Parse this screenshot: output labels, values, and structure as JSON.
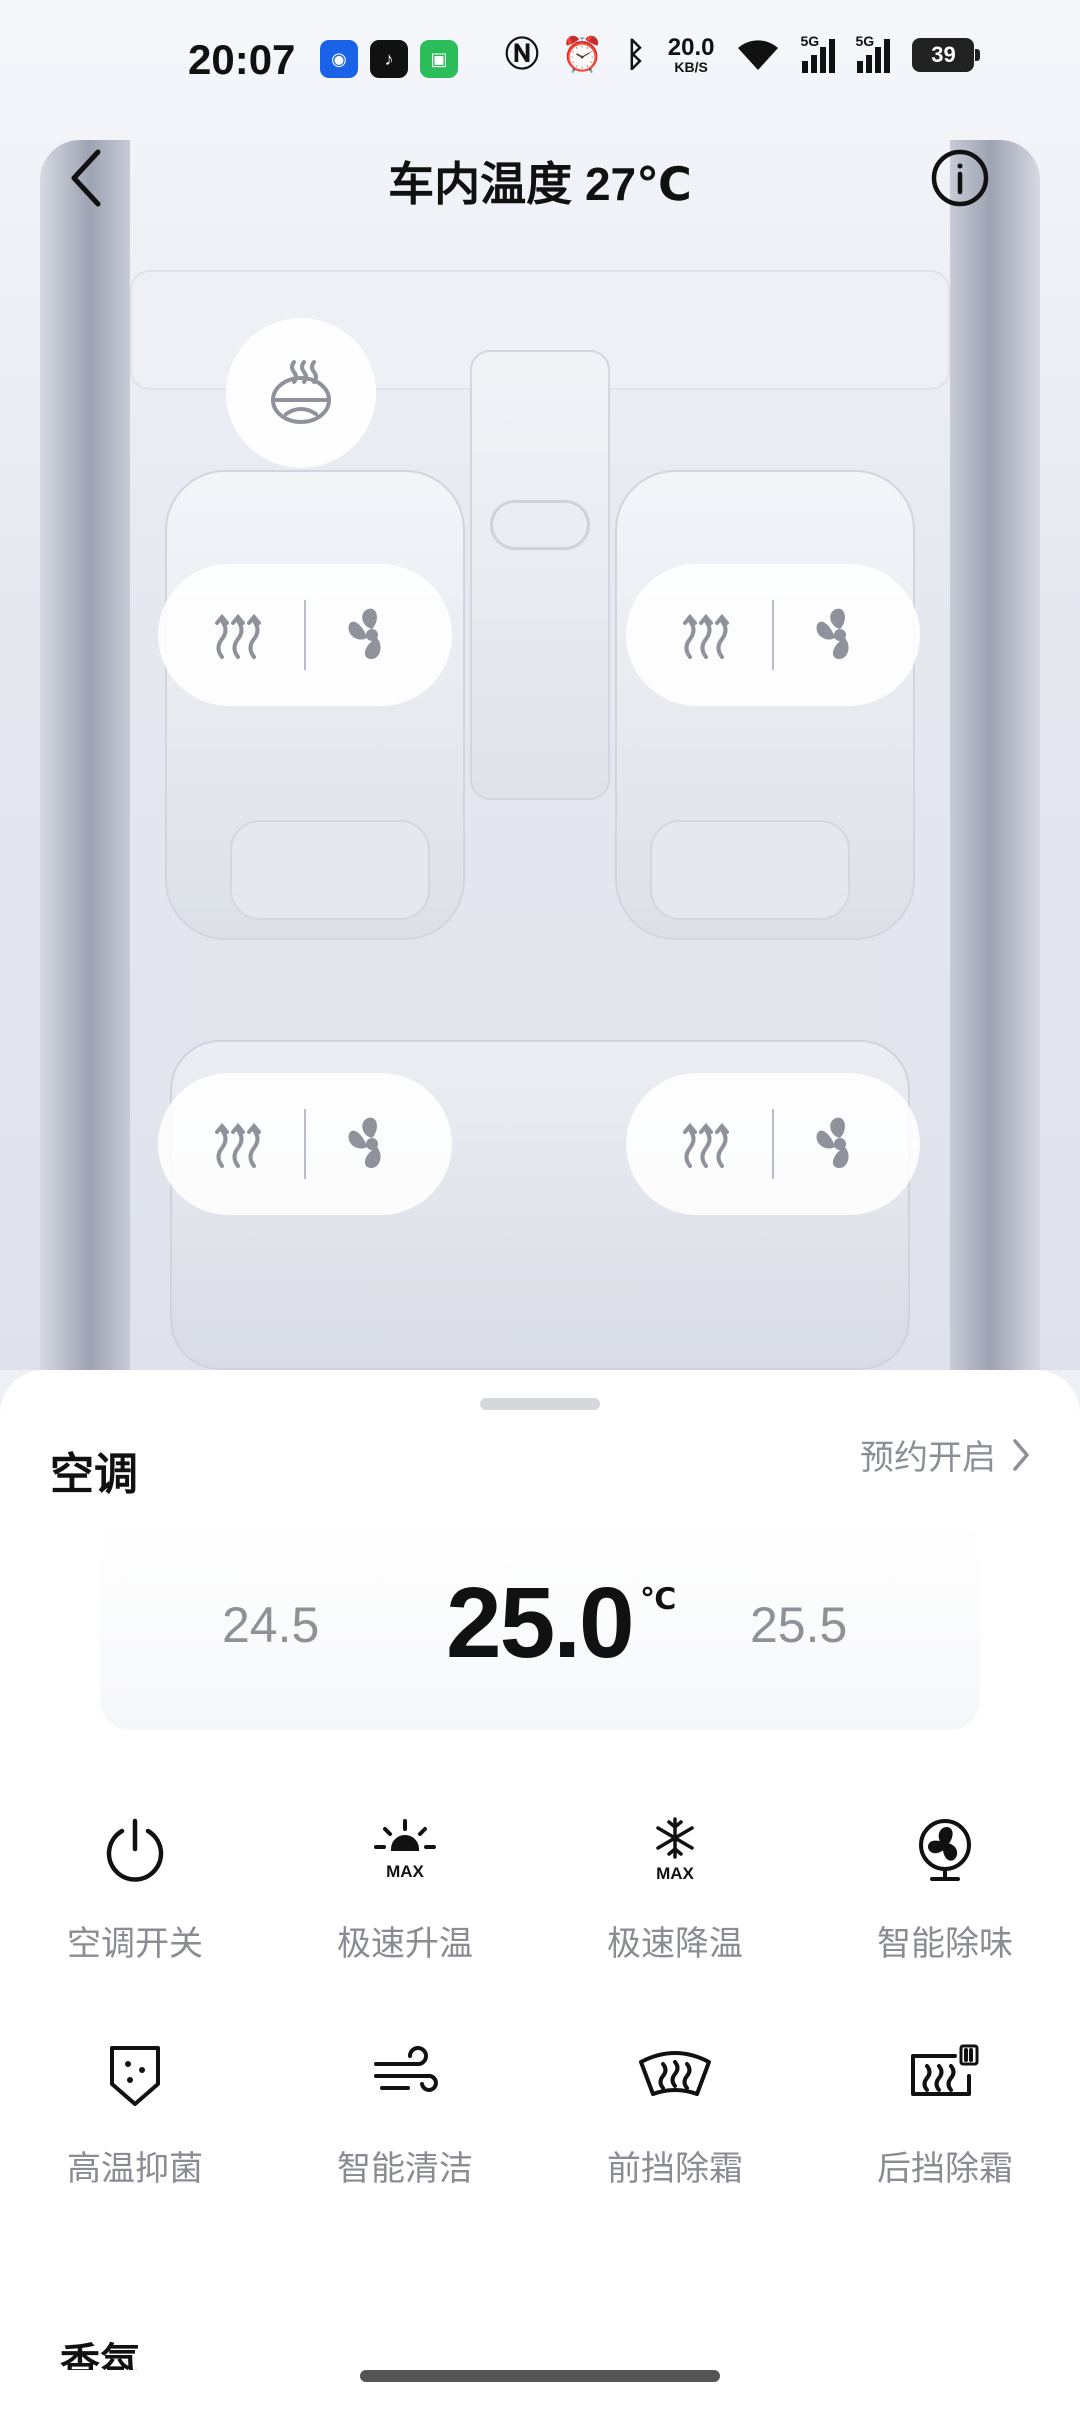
{
  "status_bar": {
    "time": "20:07",
    "net_speed_value": "20.0",
    "net_speed_unit": "KB/S",
    "signal1_tag": "5G",
    "signal2_tag": "5G",
    "battery": "39"
  },
  "header": {
    "title": "车内温度 27℃",
    "back_icon": "chevron-left-icon",
    "info_icon": "info-icon"
  },
  "car": {
    "steering_heat_icon": "steering-wheel-heat-icon",
    "seats": [
      {
        "position": "front-left",
        "heat_icon": "seat-heat-icon",
        "fan_icon": "seat-ventilation-icon"
      },
      {
        "position": "front-right",
        "heat_icon": "seat-heat-icon",
        "fan_icon": "seat-ventilation-icon"
      },
      {
        "position": "rear-left",
        "heat_icon": "seat-heat-icon",
        "fan_icon": "seat-ventilation-icon"
      },
      {
        "position": "rear-right",
        "heat_icon": "seat-heat-icon",
        "fan_icon": "seat-ventilation-icon"
      }
    ]
  },
  "ac_panel": {
    "section_title": "空调",
    "schedule_label": "预约开启",
    "temp_lower": "24.5",
    "temp_current": "25.0",
    "temp_unit": "℃",
    "temp_higher": "25.5",
    "controls": [
      {
        "label": "空调开关",
        "icon": "power-icon"
      },
      {
        "label": "极速升温",
        "icon": "sun-max-icon"
      },
      {
        "label": "极速降温",
        "icon": "snowflake-max-icon"
      },
      {
        "label": "智能除味",
        "icon": "fan-icon"
      },
      {
        "label": "高温抑菌",
        "icon": "shield-sterilize-icon"
      },
      {
        "label": "智能清洁",
        "icon": "wind-icon"
      },
      {
        "label": "前挡除霜",
        "icon": "front-defrost-icon"
      },
      {
        "label": "后挡除霜",
        "icon": "rear-defrost-icon"
      }
    ],
    "next_section_title": "香氛"
  },
  "colors": {
    "accent_text": "#111111",
    "muted_text": "#8a8c92",
    "icon_gray": "#9a9ca3"
  }
}
